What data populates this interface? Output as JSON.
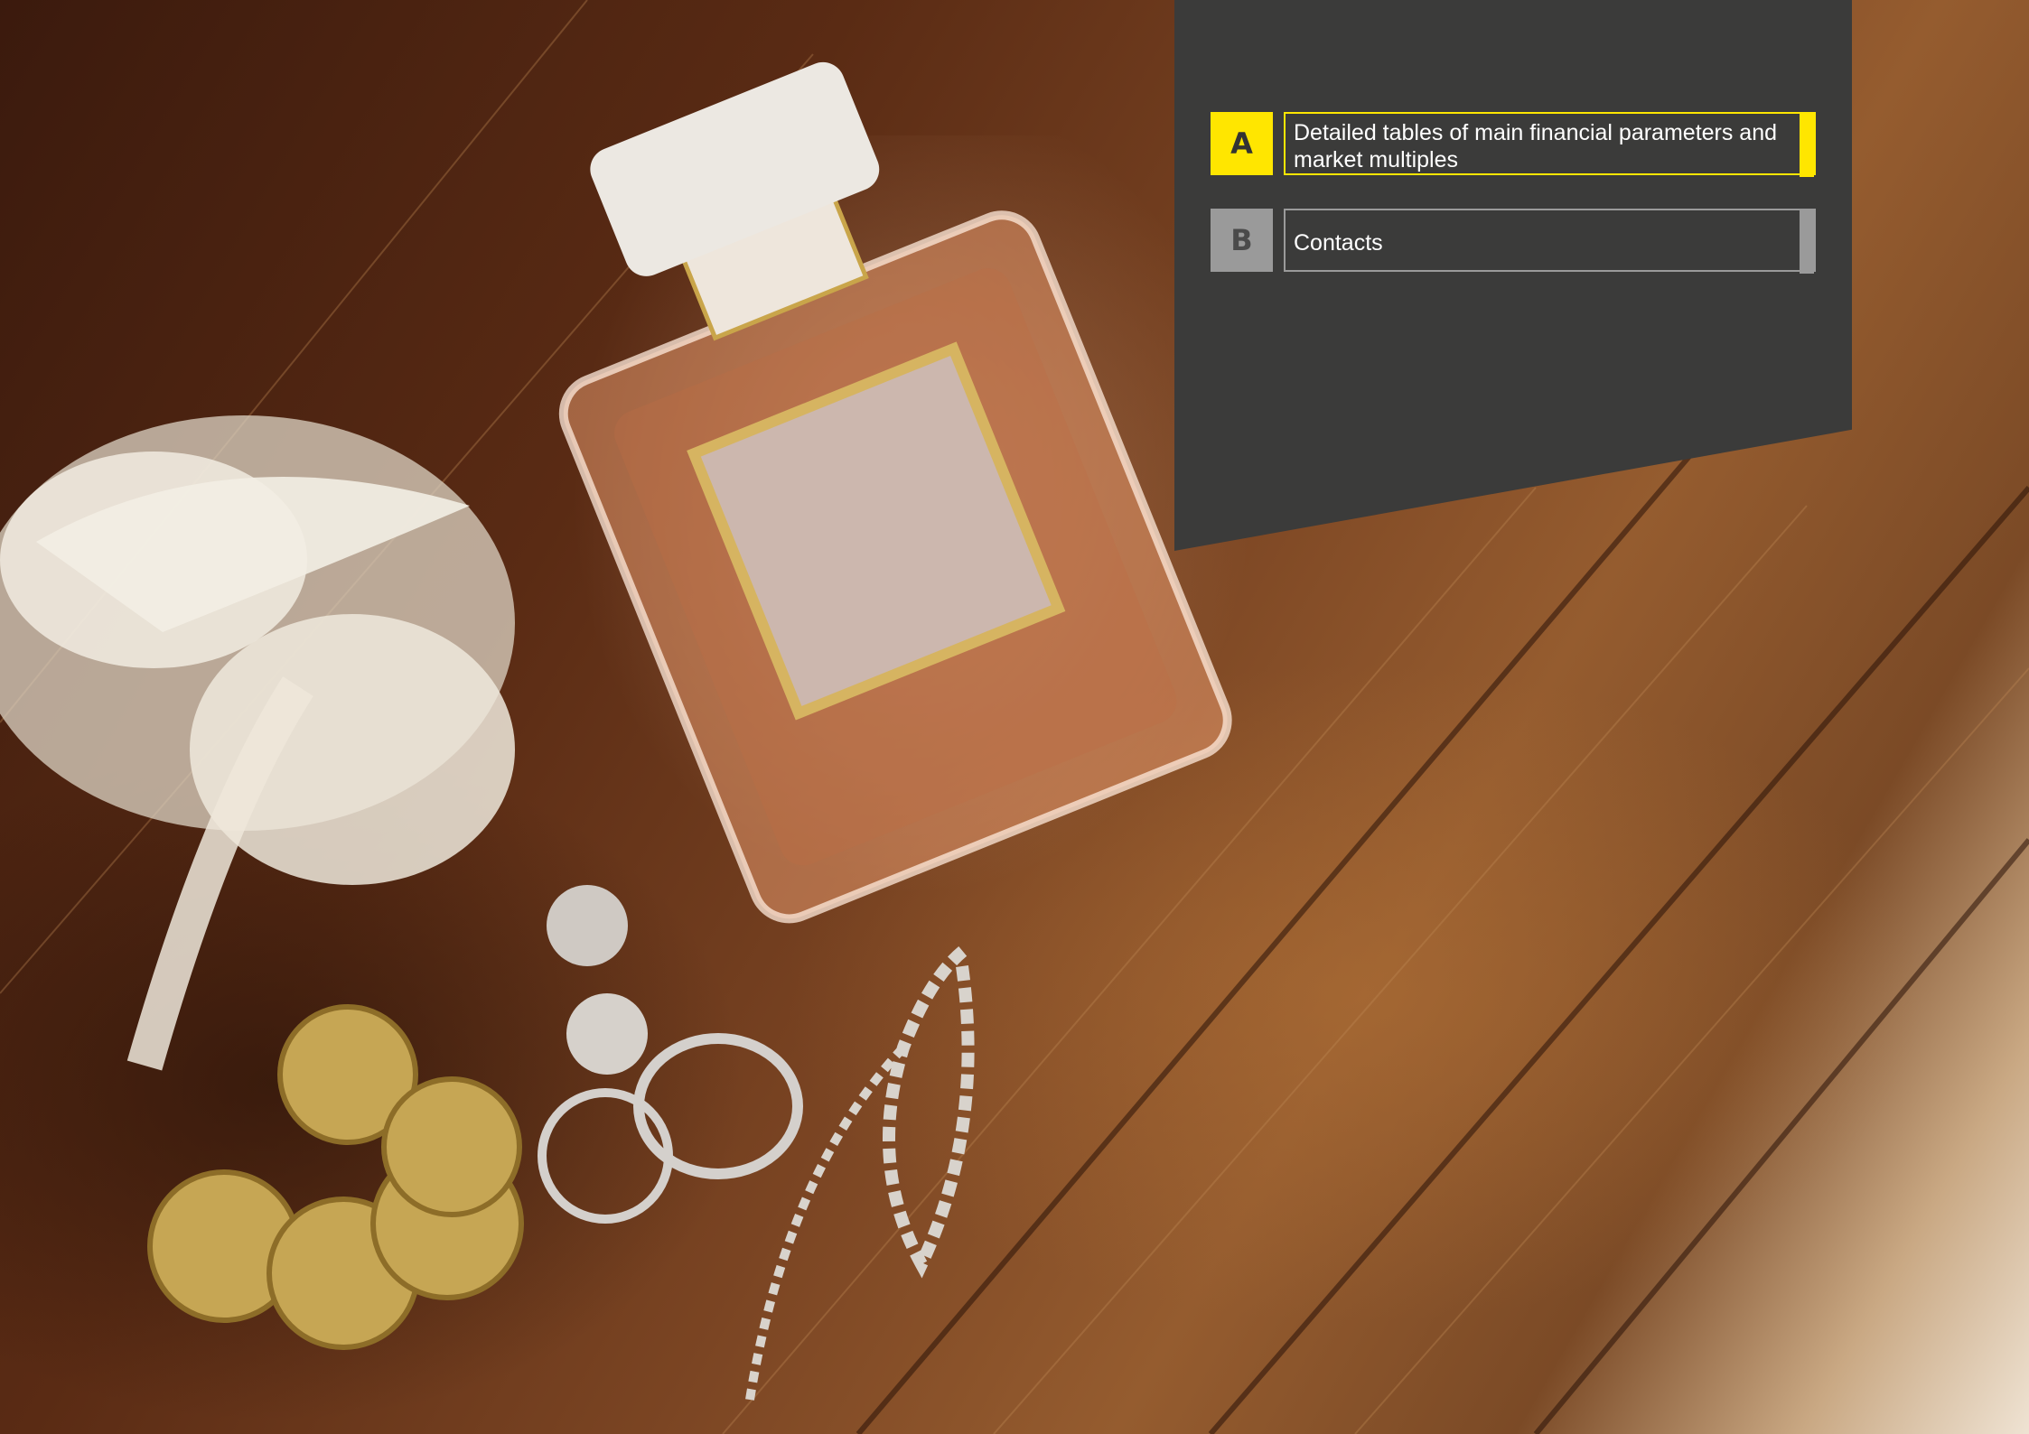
{
  "toc": {
    "items": [
      {
        "letter": "A",
        "title": "Detailed tables of main financial parameters and market multiples",
        "accent": "#ffe600"
      },
      {
        "letter": "B",
        "title": "Contacts",
        "accent": "#9a9a9a"
      }
    ]
  },
  "colors": {
    "panel": "#3b3b3a",
    "highlight": "#ffe600",
    "muted": "#9a9a9a"
  },
  "photo": {
    "subject-icons": [
      "perfume-bottle-icon",
      "wedding-garter-icon",
      "gold-coin-icon",
      "ring-icon",
      "earring-icon",
      "bracelet-icon"
    ]
  }
}
